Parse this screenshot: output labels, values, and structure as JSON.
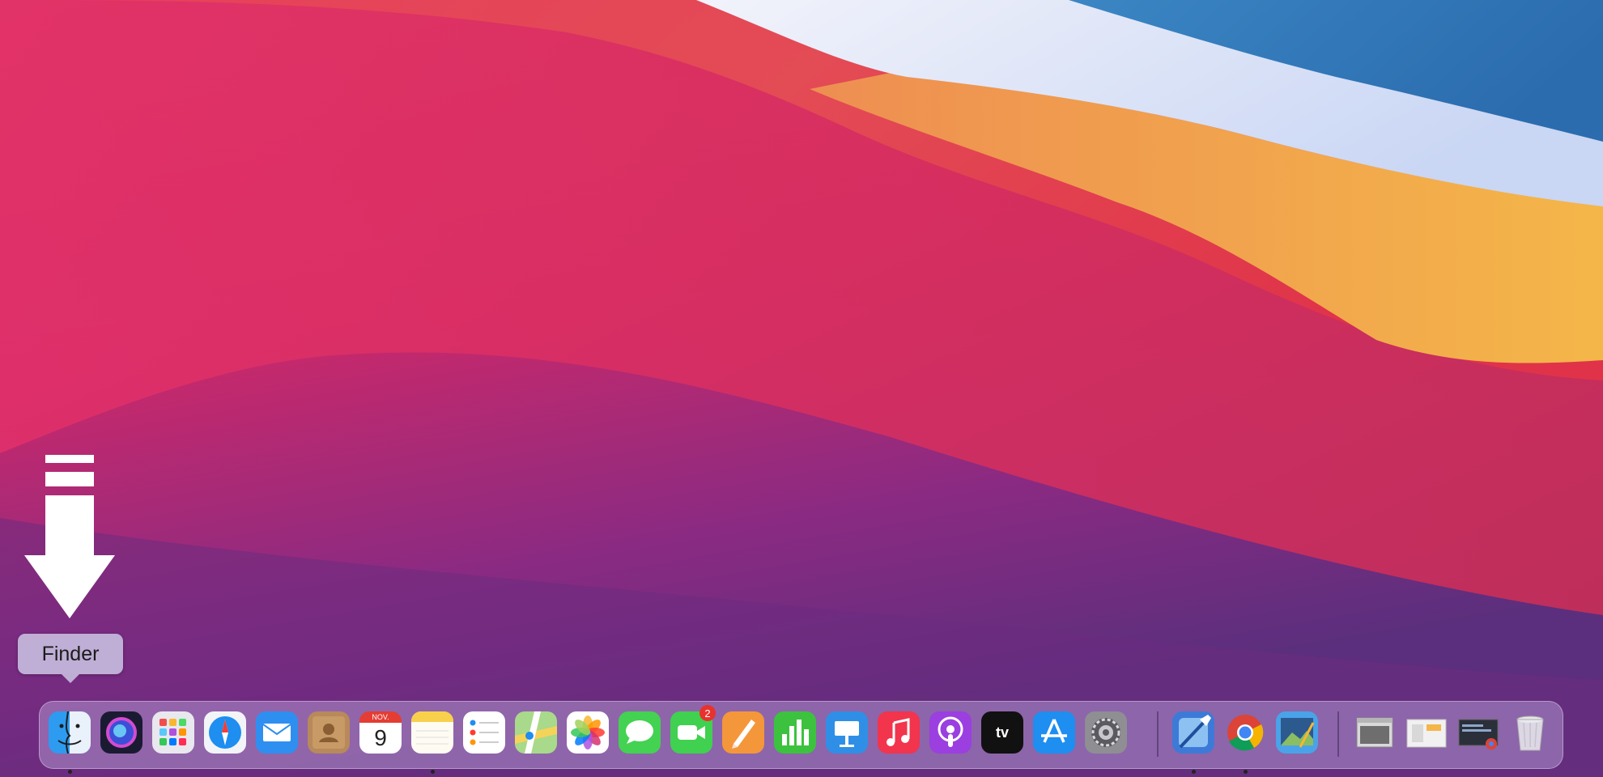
{
  "tooltip": {
    "label": "Finder"
  },
  "dock": {
    "apps": [
      {
        "name": "Finder",
        "icon": "finder-icon",
        "running": true
      },
      {
        "name": "Siri",
        "icon": "siri-icon",
        "running": false
      },
      {
        "name": "Launchpad",
        "icon": "launchpad-icon",
        "running": false
      },
      {
        "name": "Safari",
        "icon": "safari-icon",
        "running": false
      },
      {
        "name": "Mail",
        "icon": "mail-icon",
        "running": false
      },
      {
        "name": "Contacts",
        "icon": "contacts-icon",
        "running": false
      },
      {
        "name": "Calendar",
        "icon": "calendar-icon",
        "running": false,
        "month": "NOV.",
        "day": "9"
      },
      {
        "name": "Notes",
        "icon": "notes-icon",
        "running": true
      },
      {
        "name": "Reminders",
        "icon": "reminders-icon",
        "running": false
      },
      {
        "name": "Maps",
        "icon": "maps-icon",
        "running": false
      },
      {
        "name": "Photos",
        "icon": "photos-icon",
        "running": false
      },
      {
        "name": "Messages",
        "icon": "messages-icon",
        "running": false
      },
      {
        "name": "FaceTime",
        "icon": "facetime-icon",
        "running": false,
        "badge": "2"
      },
      {
        "name": "Pages",
        "icon": "pages-icon",
        "running": false
      },
      {
        "name": "Numbers",
        "icon": "numbers-icon",
        "running": false
      },
      {
        "name": "Keynote",
        "icon": "keynote-icon",
        "running": false
      },
      {
        "name": "Music",
        "icon": "music-icon",
        "running": false
      },
      {
        "name": "Podcasts",
        "icon": "podcasts-icon",
        "running": false
      },
      {
        "name": "TV",
        "icon": "apple-tv-icon",
        "running": false,
        "text": "tv"
      },
      {
        "name": "App Store",
        "icon": "app-store-icon",
        "running": false
      },
      {
        "name": "System Preferences",
        "icon": "system-preferences-icon",
        "running": false
      }
    ],
    "recent": [
      {
        "name": "Xcode",
        "icon": "xcode-icon",
        "running": true
      },
      {
        "name": "Chrome",
        "icon": "chrome-icon",
        "running": true
      },
      {
        "name": "Preview",
        "icon": "preview-icon",
        "running": false
      }
    ],
    "stacks": [
      {
        "name": "Documents",
        "icon": "documents-stack-icon"
      },
      {
        "name": "Downloads",
        "icon": "downloads-stack-icon"
      },
      {
        "name": "Screenshots",
        "icon": "screenshots-stack-icon"
      },
      {
        "name": "Trash",
        "icon": "trash-icon"
      }
    ]
  },
  "colors": {
    "wallpaper_red": "#e4344a",
    "wallpaper_purple": "#6e2a7d",
    "wallpaper_orange": "#f1a244",
    "wallpaper_blue": "#2e79b8",
    "badge_red": "#e8322e"
  }
}
